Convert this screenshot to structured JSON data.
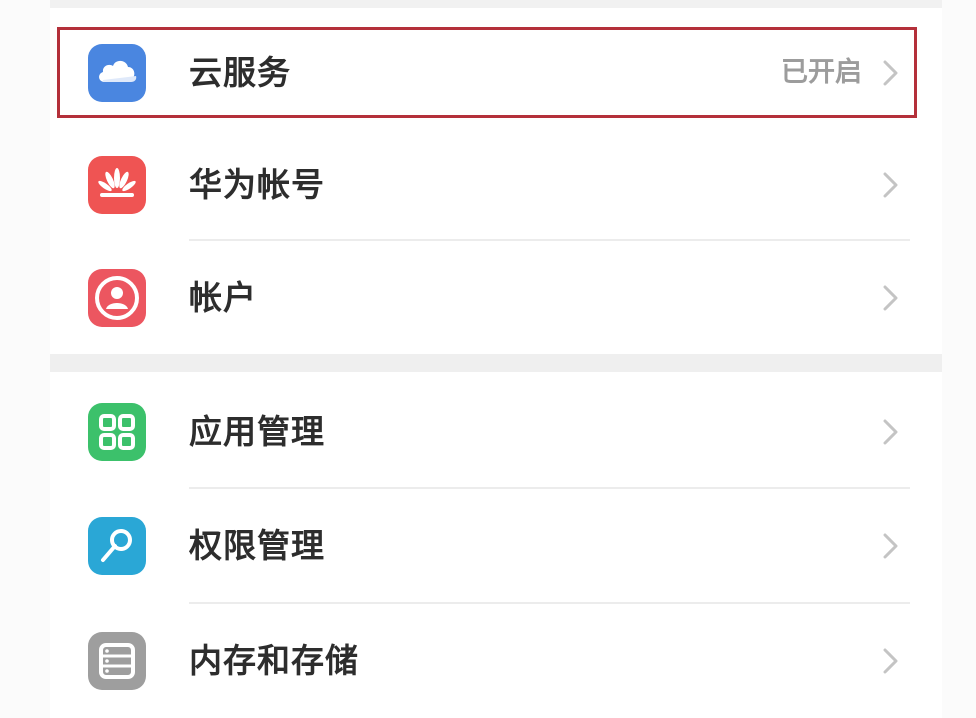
{
  "settings": {
    "section1": [
      {
        "label": "云服务",
        "status": "已开启",
        "icon": "cloud-icon",
        "color": "#4a86e0"
      },
      {
        "label": "华为帐号",
        "status": "",
        "icon": "huawei-logo-icon",
        "color": "#ef5453"
      },
      {
        "label": "帐户",
        "status": "",
        "icon": "user-icon",
        "color": "#ec5660"
      }
    ],
    "section2": [
      {
        "label": "应用管理",
        "status": "",
        "icon": "apps-grid-icon",
        "color": "#3cc16b"
      },
      {
        "label": "权限管理",
        "status": "",
        "icon": "key-icon",
        "color": "#2aa7d6"
      },
      {
        "label": "内存和存储",
        "status": "",
        "icon": "storage-list-icon",
        "color": "#9e9e9e"
      }
    ]
  },
  "highlight_color": "#b4303a"
}
